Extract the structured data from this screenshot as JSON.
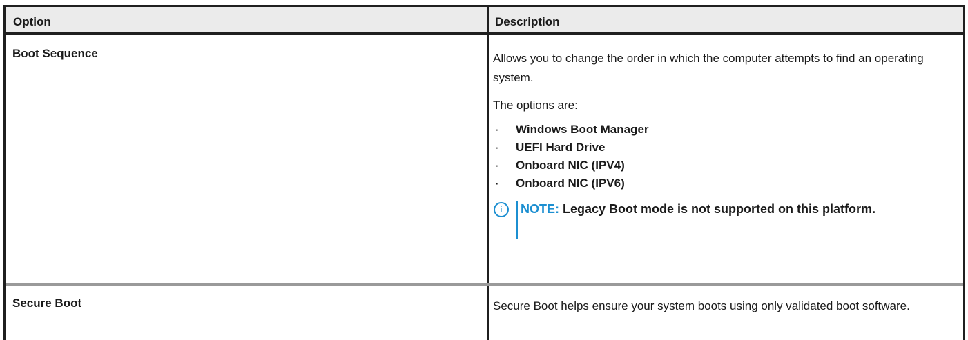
{
  "header": {
    "option": "Option",
    "description": "Description"
  },
  "rows": [
    {
      "option": "Boot Sequence",
      "description": "Allows you to change the order in which the computer attempts to find an operating system.",
      "options_intro": "The options are:",
      "bullets": [
        "Windows Boot Manager",
        "UEFI Hard Drive",
        "Onboard NIC (IPV4)",
        "Onboard NIC (IPV6)"
      ],
      "note": {
        "label": "NOTE:",
        "text": "Legacy Boot mode is not supported on this platform."
      }
    },
    {
      "option": "Secure Boot",
      "description": "Secure Boot helps ensure your system boots using only validated boot software."
    }
  ],
  "colors": {
    "header_bg": "#ebebeb",
    "border": "#1f1f1f",
    "note_accent": "#1c8fd1"
  },
  "icons": {
    "note": "info-icon"
  }
}
